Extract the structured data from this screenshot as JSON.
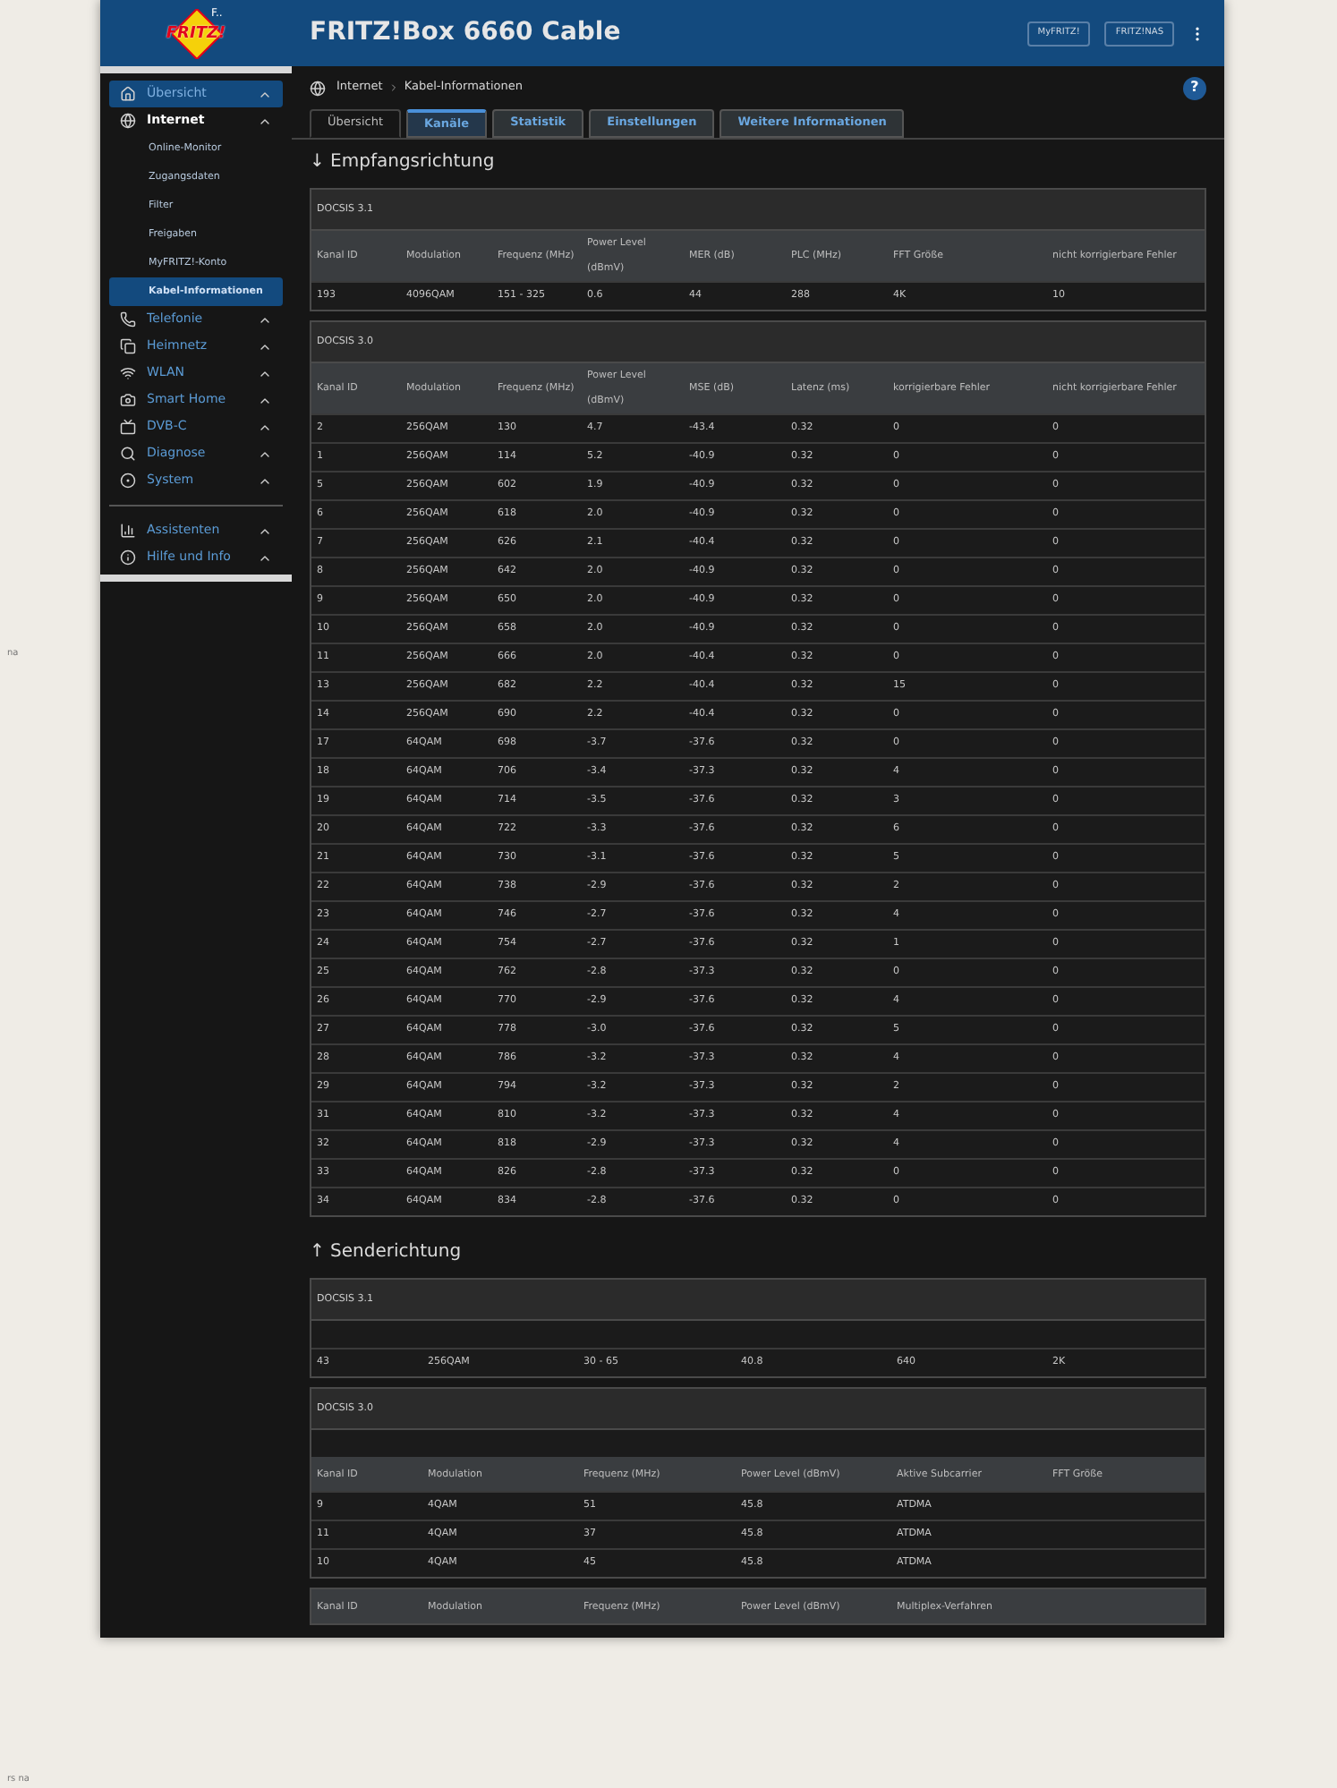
{
  "logo": {
    "text": "FRITZ!",
    "subtext": "F.."
  },
  "header": {
    "title": "FRITZ!Box 6660 Cable",
    "buttons": [
      "MyFRITZ!",
      "FRITZ!NAS"
    ]
  },
  "sidebar": {
    "items": [
      {
        "label": "Übersicht",
        "selected": true
      },
      {
        "label": "Internet",
        "selected": false,
        "children": [
          {
            "label": "Online-Monitor",
            "selected": false
          },
          {
            "label": "Zugangsdaten",
            "selected": false
          },
          {
            "label": "Filter",
            "selected": false
          },
          {
            "label": "Freigaben",
            "selected": false
          },
          {
            "label": "MyFRITZ!-Konto",
            "selected": false
          },
          {
            "label": "Kabel-Informationen",
            "selected": true
          }
        ]
      },
      {
        "label": "Telefonie",
        "selected": false
      },
      {
        "label": "Heimnetz",
        "selected": false
      },
      {
        "label": "WLAN",
        "selected": false
      },
      {
        "label": "Smart Home",
        "selected": false
      },
      {
        "label": "DVB-C",
        "selected": false
      },
      {
        "label": "Diagnose",
        "selected": false
      },
      {
        "label": "System",
        "selected": false
      }
    ],
    "bottom_items": [
      {
        "label": "Assistenten",
        "selected": false
      },
      {
        "label": "Hilfe und Info",
        "selected": false
      }
    ]
  },
  "breadcrumb": [
    "Internet",
    "Kabel-Informationen"
  ],
  "help_button": "?",
  "tabs": [
    {
      "label": "Übersicht",
      "selected": false,
      "kind": "plain"
    },
    {
      "label": "Kanäle",
      "selected": true,
      "kind": "tab"
    },
    {
      "label": "Statistik",
      "selected": false,
      "kind": "tab"
    },
    {
      "label": "Einstellungen",
      "selected": false,
      "kind": "tab"
    },
    {
      "label": "Weitere Informationen",
      "selected": false,
      "kind": "tab"
    }
  ],
  "sections": [
    {
      "heading": "↓ Empfangsrichtung",
      "tables": [
        {
          "kind": "down",
          "title": "DOCSIS 3.1",
          "columns": [
            "Kanal ID",
            "Modulation",
            "Frequenz (MHz)",
            "Power Level (dBmV)",
            "MER (dB)",
            "PLC (MHz)",
            "FFT Größe",
            "nicht korrigierbare Fehler"
          ],
          "rows": [
            [
              "193",
              "4096QAM",
              "151 - 325",
              "0.6",
              "44",
              "288",
              "4K",
              "10"
            ]
          ]
        },
        {
          "kind": "down",
          "title": "DOCSIS 3.0",
          "columns": [
            "Kanal ID",
            "Modulation",
            "Frequenz (MHz)",
            "Power Level (dBmV)",
            "MSE (dB)",
            "Latenz (ms)",
            "korrigierbare Fehler",
            "nicht korrigierbare Fehler"
          ],
          "rows": [
            [
              "2",
              "256QAM",
              "130",
              "4.7",
              "-43.4",
              "0.32",
              "0",
              "0"
            ],
            [
              "1",
              "256QAM",
              "114",
              "5.2",
              "-40.9",
              "0.32",
              "0",
              "0"
            ],
            [
              "5",
              "256QAM",
              "602",
              "1.9",
              "-40.9",
              "0.32",
              "0",
              "0"
            ],
            [
              "6",
              "256QAM",
              "618",
              "2.0",
              "-40.9",
              "0.32",
              "0",
              "0"
            ],
            [
              "7",
              "256QAM",
              "626",
              "2.1",
              "-40.4",
              "0.32",
              "0",
              "0"
            ],
            [
              "8",
              "256QAM",
              "642",
              "2.0",
              "-40.9",
              "0.32",
              "0",
              "0"
            ],
            [
              "9",
              "256QAM",
              "650",
              "2.0",
              "-40.9",
              "0.32",
              "0",
              "0"
            ],
            [
              "10",
              "256QAM",
              "658",
              "2.0",
              "-40.9",
              "0.32",
              "0",
              "0"
            ],
            [
              "11",
              "256QAM",
              "666",
              "2.0",
              "-40.4",
              "0.32",
              "0",
              "0"
            ],
            [
              "13",
              "256QAM",
              "682",
              "2.2",
              "-40.4",
              "0.32",
              "15",
              "0"
            ],
            [
              "14",
              "256QAM",
              "690",
              "2.2",
              "-40.4",
              "0.32",
              "0",
              "0"
            ],
            [
              "17",
              "64QAM",
              "698",
              "-3.7",
              "-37.6",
              "0.32",
              "0",
              "0"
            ],
            [
              "18",
              "64QAM",
              "706",
              "-3.4",
              "-37.3",
              "0.32",
              "4",
              "0"
            ],
            [
              "19",
              "64QAM",
              "714",
              "-3.5",
              "-37.6",
              "0.32",
              "3",
              "0"
            ],
            [
              "20",
              "64QAM",
              "722",
              "-3.3",
              "-37.6",
              "0.32",
              "6",
              "0"
            ],
            [
              "21",
              "64QAM",
              "730",
              "-3.1",
              "-37.6",
              "0.32",
              "5",
              "0"
            ],
            [
              "22",
              "64QAM",
              "738",
              "-2.9",
              "-37.6",
              "0.32",
              "2",
              "0"
            ],
            [
              "23",
              "64QAM",
              "746",
              "-2.7",
              "-37.6",
              "0.32",
              "4",
              "0"
            ],
            [
              "24",
              "64QAM",
              "754",
              "-2.7",
              "-37.6",
              "0.32",
              "1",
              "0"
            ],
            [
              "25",
              "64QAM",
              "762",
              "-2.8",
              "-37.3",
              "0.32",
              "0",
              "0"
            ],
            [
              "26",
              "64QAM",
              "770",
              "-2.9",
              "-37.6",
              "0.32",
              "4",
              "0"
            ],
            [
              "27",
              "64QAM",
              "778",
              "-3.0",
              "-37.6",
              "0.32",
              "5",
              "0"
            ],
            [
              "28",
              "64QAM",
              "786",
              "-3.2",
              "-37.3",
              "0.32",
              "4",
              "0"
            ],
            [
              "29",
              "64QAM",
              "794",
              "-3.2",
              "-37.3",
              "0.32",
              "2",
              "0"
            ],
            [
              "31",
              "64QAM",
              "810",
              "-3.2",
              "-37.3",
              "0.32",
              "4",
              "0"
            ],
            [
              "32",
              "64QAM",
              "818",
              "-2.9",
              "-37.3",
              "0.32",
              "4",
              "0"
            ],
            [
              "33",
              "64QAM",
              "826",
              "-2.8",
              "-37.3",
              "0.32",
              "0",
              "0"
            ],
            [
              "34",
              "64QAM",
              "834",
              "-2.8",
              "-37.6",
              "0.32",
              "0",
              "0"
            ]
          ]
        }
      ]
    },
    {
      "heading": "↑ Senderichtung",
      "tables": [
        {
          "kind": "up",
          "title": "DOCSIS 3.1",
          "rows": [
            [
              "43",
              "256QAM",
              "30 - 65",
              "40.8",
              "640",
              "2K"
            ]
          ]
        },
        {
          "kind": "up",
          "title": "DOCSIS 3.0",
          "columns": [
            "Kanal ID",
            "Modulation",
            "Frequenz (MHz)",
            "Power Level (dBmV)",
            "Aktive Subcarrier",
            "FFT Größe"
          ],
          "rows": [
            [
              "9",
              "4QAM",
              "51",
              "45.8",
              "ATDMA"
            ],
            [
              "11",
              "4QAM",
              "37",
              "45.8",
              "ATDMA"
            ],
            [
              "10",
              "4QAM",
              "45",
              "45.8",
              "ATDMA"
            ]
          ]
        },
        {
          "kind": "partial",
          "columns": [
            "Kanal ID",
            "Modulation",
            "Frequenz (MHz)",
            "Power Level (dBmV)",
            "Multiplex-Verfahren"
          ]
        }
      ]
    }
  ],
  "stray_texts": [
    "na",
    "rs na"
  ]
}
